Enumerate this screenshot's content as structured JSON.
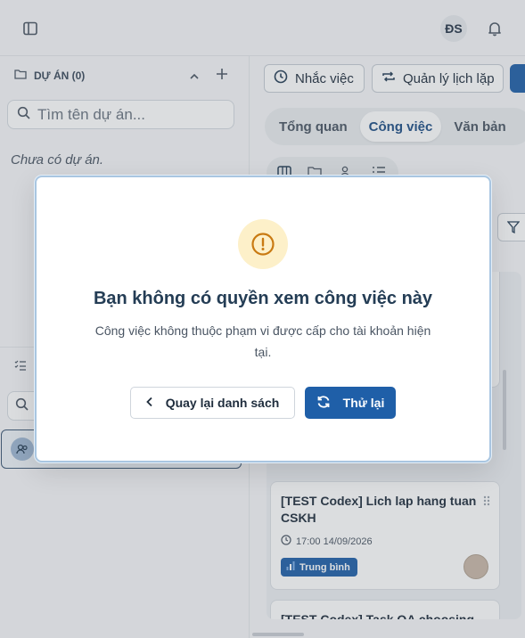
{
  "topbar": {
    "user_initials": "ĐS",
    "icons": [
      "sidebar-toggle-icon",
      "bell-icon"
    ]
  },
  "project_panel": {
    "title": "DỰ ÁN (0)",
    "search_placeholder": "Tìm tên dự án...",
    "empty_text": "Chưa có dự án."
  },
  "toolbar": {
    "reminder_label": "Nhắc việc",
    "schedule_label": "Quản lý lịch lặp"
  },
  "tabs": [
    {
      "label": "Tổng quan",
      "active": false
    },
    {
      "label": "Công việc",
      "active": true
    },
    {
      "label": "Văn bản",
      "active": false
    }
  ],
  "cards": [
    {
      "title": "[TEST Codex] Lich lap hang tuan CSKH",
      "time": "17:00 14/09/2026",
      "priority": "Trung bình"
    },
    {
      "title": "[TEST Codex] Task QA choosing"
    }
  ],
  "modal": {
    "title": "Bạn không có quyền xem công việc này",
    "description": "Công việc không thuộc phạm vi được cấp cho tài khoản hiện tại.",
    "back_label": "Quay lại danh sách",
    "retry_label": "Thử lại"
  },
  "colors": {
    "primary": "#1f5fa8",
    "warning_bg": "#fdf0c9",
    "warning_icon": "#c97a12",
    "modal_border": "#a9c6e1"
  }
}
